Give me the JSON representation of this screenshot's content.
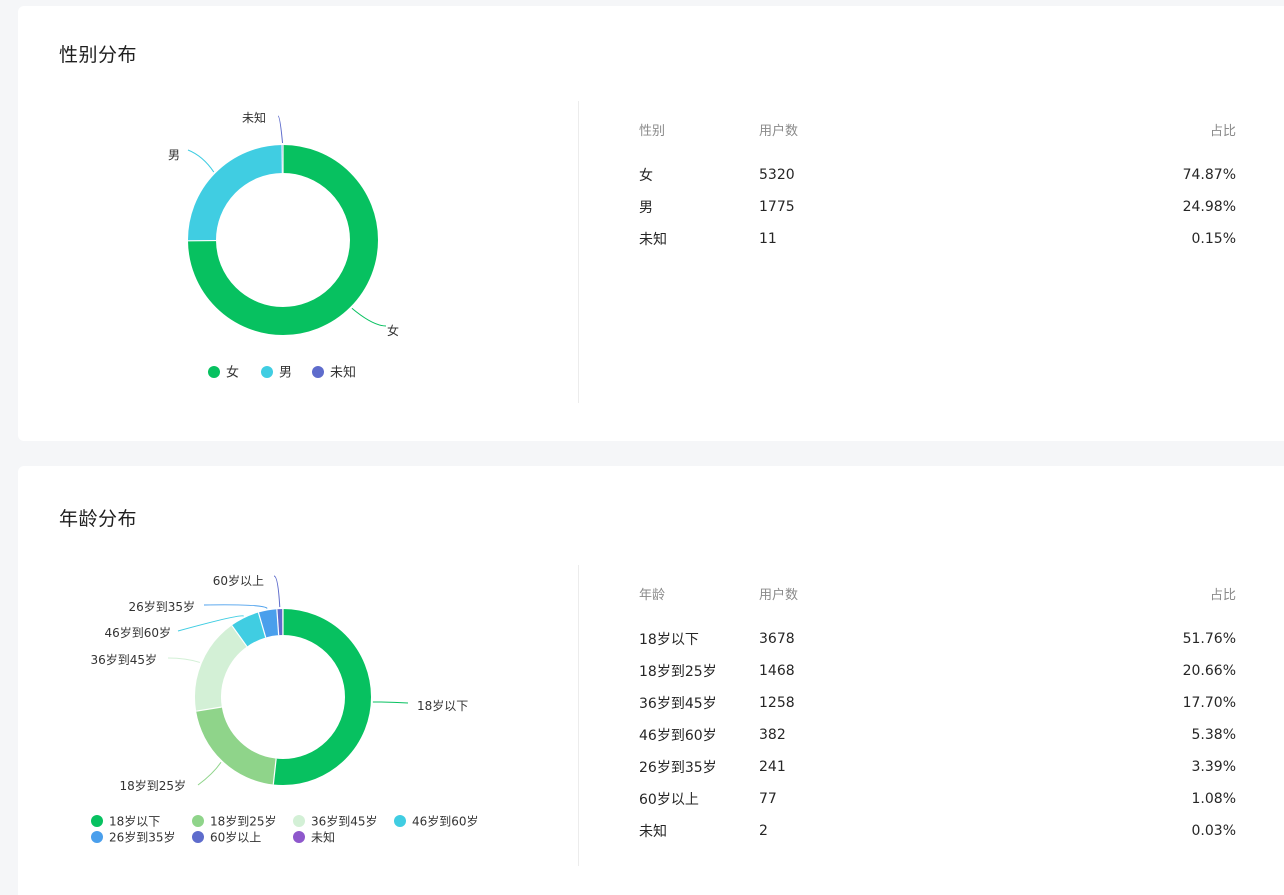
{
  "gender": {
    "title": "性别分布",
    "table": {
      "headers": [
        "性别",
        "用户数",
        "占比"
      ],
      "rows": [
        [
          "女",
          "5320",
          "74.87%"
        ],
        [
          "男",
          "1775",
          "24.98%"
        ],
        [
          "未知",
          "11",
          "0.15%"
        ]
      ]
    }
  },
  "age": {
    "title": "年龄分布",
    "table": {
      "headers": [
        "年龄",
        "用户数",
        "占比"
      ],
      "rows": [
        [
          "18岁以下",
          "3678",
          "51.76%"
        ],
        [
          "18岁到25岁",
          "1468",
          "20.66%"
        ],
        [
          "36岁到45岁",
          "1258",
          "17.70%"
        ],
        [
          "46岁到60岁",
          "382",
          "5.38%"
        ],
        [
          "26岁到35岁",
          "241",
          "3.39%"
        ],
        [
          "60岁以上",
          "77",
          "1.08%"
        ],
        [
          "未知",
          "2",
          "0.03%"
        ]
      ]
    }
  },
  "chart_data": [
    {
      "type": "pie",
      "title": "性别分布",
      "categories": [
        "女",
        "男",
        "未知"
      ],
      "values": [
        5320,
        1775,
        11
      ],
      "colors": [
        "#07c160",
        "#40cde2",
        "#5e6ccc"
      ],
      "legend": "bottom"
    },
    {
      "type": "pie",
      "title": "年龄分布",
      "categories": [
        "18岁以下",
        "18岁到25岁",
        "36岁到45岁",
        "46岁到60岁",
        "26岁到35岁",
        "60岁以上",
        "未知"
      ],
      "values": [
        3678,
        1468,
        1258,
        382,
        241,
        77,
        2
      ],
      "colors": [
        "#07c160",
        "#8fd48a",
        "#d3f0d6",
        "#40cde2",
        "#4a9fec",
        "#5e6ccc",
        "#8e58cc"
      ],
      "legend": "bottom"
    }
  ]
}
